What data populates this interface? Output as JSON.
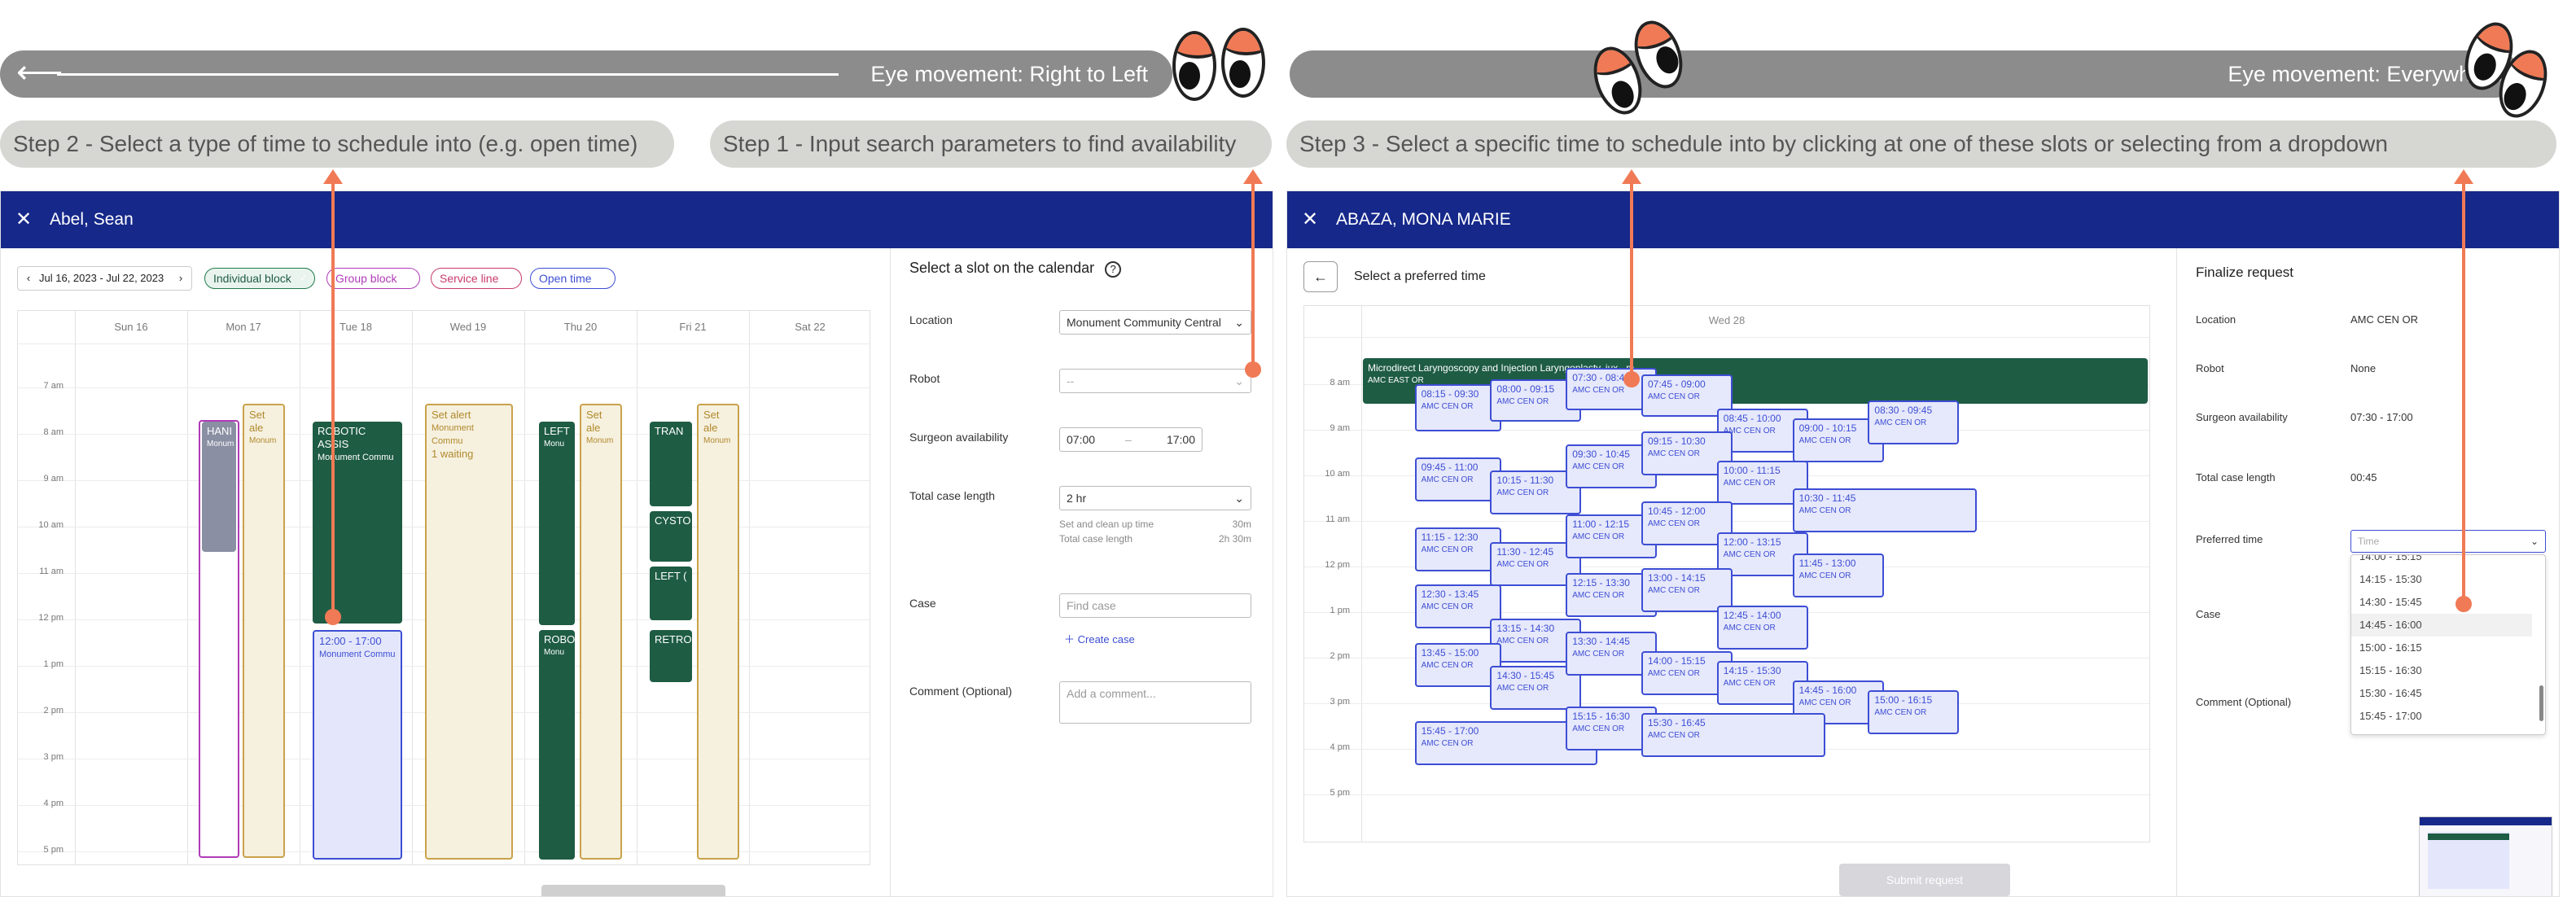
{
  "banners": {
    "left": "Eye movement: Right to Left",
    "right": "Eye movement: Everywhere"
  },
  "steps": {
    "step2": "Step 2 - Select a type of time to schedule into (e.g. open time)",
    "step1": "Step 1 - Input search parameters to find availability",
    "step3": "Step 3 - Select a specific time to schedule into by clicking at one of these slots or selecting from a dropdown"
  },
  "colors": {
    "header": "#16288a",
    "accent": "#f07a55",
    "event_green": "#1e5c44",
    "slot_blue": "#3d4ed4"
  },
  "left_panel": {
    "patient": "Abel, Sean",
    "date_range": "Jul 16, 2023 - Jul 22, 2023",
    "filters": [
      {
        "label": "Individual block",
        "color": "#1e7a4a"
      },
      {
        "label": "Group block",
        "color": "#b03ab8"
      },
      {
        "label": "Service line",
        "color": "#c83a6e"
      },
      {
        "label": "Open time",
        "color": "#3d4ed4"
      }
    ],
    "days": [
      "Sun 16",
      "Mon 17",
      "Tue 18",
      "Wed 19",
      "Thu 20",
      "Fri 21",
      "Sat 22"
    ],
    "hours": [
      "7 am",
      "8 am",
      "9 am",
      "10 am",
      "11 am",
      "12 pm",
      "1 pm",
      "2 pm",
      "3 pm",
      "4 pm",
      "5 pm"
    ],
    "events": {
      "mon_hand": "HANI",
      "mon_hand_sub": "Monum",
      "mon_alert": "Set ale",
      "mon_alert_sub": "Monum",
      "tue_robot": "ROBOTIC ASSIS",
      "tue_robot_sub": "Monument Commu",
      "tue_open": "12:00 - 17:00",
      "tue_open_sub": "Monument Commu",
      "wed_alert": "Set alert",
      "wed_alert_sub": "Monument Commu",
      "wed_alert_waiting": "1 waiting",
      "thu_left": "LEFT",
      "thu_left_sub": "Monu",
      "thu_robo": "ROBO",
      "thu_robo_sub": "Monu",
      "thu_alert": "Set ale",
      "thu_alert_sub": "Monum",
      "fri_trans": "TRAN",
      "fri_cysto": "CYSTO",
      "fri_left": "LEFT (",
      "fri_retro": "RETRO",
      "fri_alert": "Set ale",
      "fri_alert_sub": "Monum"
    },
    "form": {
      "title": "Select a slot on the calendar",
      "location_label": "Location",
      "location_value": "Monument Community Central",
      "robot_label": "Robot",
      "robot_value": "--",
      "surgeon_label": "Surgeon availability",
      "surgeon_from": "07:00",
      "surgeon_sep": "–",
      "surgeon_to": "17:00",
      "case_length_label": "Total case length",
      "case_length_value": "2 hr",
      "cleanup_label": "Set and clean up time",
      "cleanup_value": "30m",
      "total_label": "Total case length",
      "total_value": "2h 30m",
      "case_label": "Case",
      "case_placeholder": "Find case",
      "create_case": "Create case",
      "comment_label": "Comment (Optional)",
      "comment_placeholder": "Add a comment..."
    }
  },
  "right_panel": {
    "patient": "ABAZA, MONA MARIE",
    "back_title": "Select a preferred time",
    "day": "Wed 28",
    "hours": [
      "8 am",
      "9 am",
      "10 am",
      "11 am",
      "12 pm",
      "1 pm",
      "2 pm",
      "3 pm",
      "4 pm",
      "5 pm"
    ],
    "banner_event": "Microdirect Laryngoscopy and Injection Laryngoplasty, jux...m",
    "banner_event_sub": "AMC EAST OR",
    "slot_sub": "AMC CEN OR",
    "slots": [
      "08:15 - 09:30",
      "08:00 - 09:15",
      "07:30 - 08:45",
      "07:45 - 09:00",
      "08:45 - 10:00",
      "09:00 - 10:15",
      "08:30 - 09:45",
      "09:45 - 11:00",
      "10:15 - 11:30",
      "09:30 - 10:45",
      "09:15 - 10:30",
      "10:00 - 11:15",
      "10:30 - 11:45",
      "11:15 - 12:30",
      "11:30 - 12:45",
      "11:00 - 12:15",
      "10:45 - 12:00",
      "12:00 - 13:15",
      "11:45 - 13:00",
      "12:30 - 13:45",
      "13:15 - 14:30",
      "12:15 - 13:30",
      "13:00 - 14:15",
      "12:45 - 14:00",
      "13:45 - 15:00",
      "14:30 - 15:45",
      "13:30 - 14:45",
      "14:00 - 15:15",
      "14:15 - 15:30",
      "14:45 - 16:00",
      "15:00 - 16:15",
      "15:45 - 17:00",
      "15:15 - 16:30",
      "15:30 - 16:45"
    ],
    "submit": "Submit request",
    "finalize": {
      "title": "Finalize request",
      "location_label": "Location",
      "location_value": "AMC CEN OR",
      "robot_label": "Robot",
      "robot_value": "None",
      "surgeon_label": "Surgeon availability",
      "surgeon_value": "07:30 - 17:00",
      "case_length_label": "Total case length",
      "case_length_value": "00:45",
      "preferred_label": "Preferred time",
      "preferred_placeholder": "Time",
      "case_label": "Case",
      "comment_label": "Comment (Optional)",
      "options": [
        "14:00 - 15:15",
        "14:15 - 15:30",
        "14:30 - 15:45",
        "14:45 - 16:00",
        "15:00 - 16:15",
        "15:15 - 16:30",
        "15:30 - 16:45",
        "15:45 - 17:00"
      ]
    }
  }
}
